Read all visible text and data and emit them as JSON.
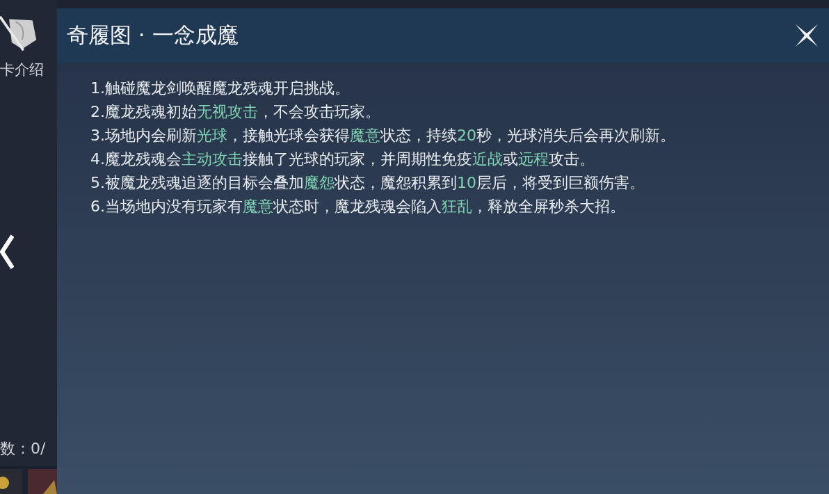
{
  "sidebar": {
    "label": "卡介绍",
    "counter": "数：0/"
  },
  "dialog": {
    "title": "奇履图 · 一念成魔",
    "rules": [
      {
        "segments": [
          {
            "text": "1.触碰魔龙剑唤醒魔龙残魂开启挑战。",
            "kind": "plain"
          }
        ]
      },
      {
        "segments": [
          {
            "text": "2.魔龙残魂初始",
            "kind": "plain"
          },
          {
            "text": "无视攻击",
            "kind": "keyword"
          },
          {
            "text": "，不会攻击玩家。",
            "kind": "plain"
          }
        ]
      },
      {
        "segments": [
          {
            "text": "3.场地内会刷新",
            "kind": "plain"
          },
          {
            "text": "光球",
            "kind": "keyword"
          },
          {
            "text": "，接触光球会获得",
            "kind": "plain"
          },
          {
            "text": "魔意",
            "kind": "keyword"
          },
          {
            "text": "状态，持续",
            "kind": "plain"
          },
          {
            "text": "20",
            "kind": "keyword"
          },
          {
            "text": "秒，光球消失后会再次刷新。",
            "kind": "plain"
          }
        ]
      },
      {
        "segments": [
          {
            "text": "4.魔龙残魂会",
            "kind": "plain"
          },
          {
            "text": "主动攻击",
            "kind": "keyword"
          },
          {
            "text": "接触了光球的玩家，并周期性免疫",
            "kind": "plain"
          },
          {
            "text": "近战",
            "kind": "keyword"
          },
          {
            "text": "或",
            "kind": "plain"
          },
          {
            "text": "远程",
            "kind": "keyword"
          },
          {
            "text": "攻击。",
            "kind": "plain"
          }
        ]
      },
      {
        "segments": [
          {
            "text": "5.被魔龙残魂追逐的目标会叠加",
            "kind": "plain"
          },
          {
            "text": "魔怨",
            "kind": "keyword"
          },
          {
            "text": "状态，魔怨积累到",
            "kind": "plain"
          },
          {
            "text": "10",
            "kind": "keyword"
          },
          {
            "text": "层后，将受到巨额伤害。",
            "kind": "plain"
          }
        ]
      },
      {
        "segments": [
          {
            "text": "6.当场地内没有玩家有",
            "kind": "plain"
          },
          {
            "text": "魔意",
            "kind": "keyword"
          },
          {
            "text": "状态时，魔龙残魂会陷入",
            "kind": "plain"
          },
          {
            "text": "狂乱",
            "kind": "keyword"
          },
          {
            "text": "，释放全屏秒杀大招。",
            "kind": "plain"
          }
        ]
      }
    ]
  }
}
